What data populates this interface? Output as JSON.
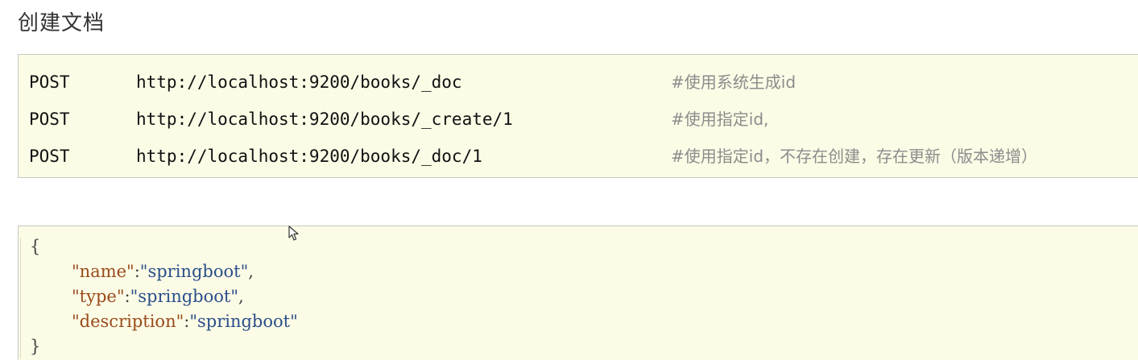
{
  "title": "创建文档",
  "requests": [
    {
      "method": "POST",
      "url": "http://localhost:9200/books/_doc",
      "comment": "#使用系统生成id"
    },
    {
      "method": "POST",
      "url": "http://localhost:9200/books/_create/1",
      "comment": "#使用指定id,"
    },
    {
      "method": "POST",
      "url": "http://localhost:9200/books/_doc/1",
      "comment": "#使用指定id，不存在创建，存在更新（版本递增）"
    }
  ],
  "json_body": {
    "open_brace": "{",
    "close_brace": "}",
    "fields": [
      {
        "key": "\"name\"",
        "sep": ":",
        "value": "\"springboot\"",
        "trail": ","
      },
      {
        "key": "\"type\"",
        "sep": ":",
        "value": "\"springboot\"",
        "trail": ","
      },
      {
        "key": "\"description\"",
        "sep": ":",
        "value": "\"springboot\"",
        "trail": ""
      }
    ]
  },
  "icons": {
    "cursor": "mouse-pointer-icon"
  },
  "colors": {
    "code_background": "#fbfbe6",
    "comment": "#8c8c8c",
    "json_key": "#9a4a1a",
    "json_string": "#2a4f8a"
  }
}
